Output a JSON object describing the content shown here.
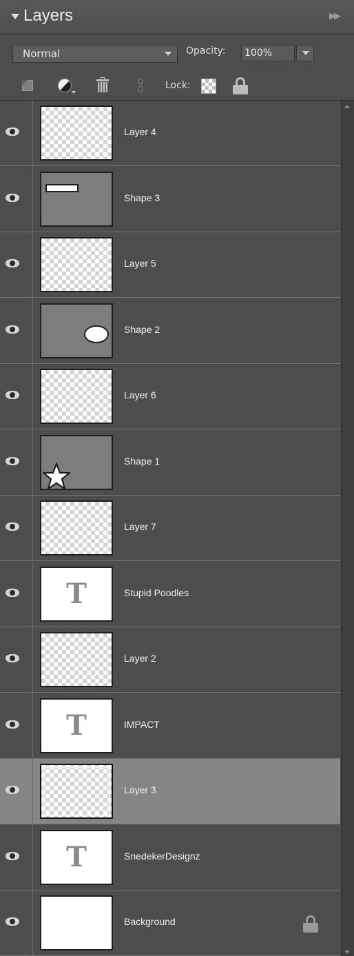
{
  "panel": {
    "title": "Layers",
    "menu_glyph": "▶▶"
  },
  "options": {
    "blend_mode": "Normal",
    "opacity_label": "Opacity:",
    "opacity_value": "100%"
  },
  "tools": {
    "lock_label": "Lock:"
  },
  "layers": [
    {
      "name": "Layer 4",
      "thumb": "transparent",
      "visible": true
    },
    {
      "name": "Shape 3",
      "thumb": "shape-rectangle",
      "visible": true
    },
    {
      "name": "Layer 5",
      "thumb": "transparent",
      "visible": true
    },
    {
      "name": "Shape 2",
      "thumb": "shape-ellipse",
      "visible": true
    },
    {
      "name": "Layer 6",
      "thumb": "transparent",
      "visible": true
    },
    {
      "name": "Shape 1",
      "thumb": "shape-star",
      "visible": true
    },
    {
      "name": "Layer 7",
      "thumb": "transparent",
      "visible": true
    },
    {
      "name": "Stupid Poodles",
      "thumb": "text",
      "thumb_glyph": "T",
      "visible": true
    },
    {
      "name": "Layer 2",
      "thumb": "transparent",
      "visible": true
    },
    {
      "name": "IMPACT",
      "thumb": "text",
      "thumb_glyph": "T",
      "visible": true
    },
    {
      "name": "Layer 3",
      "thumb": "transparent",
      "visible": true,
      "selected": true
    },
    {
      "name": "SnedekerDesignz",
      "thumb": "text",
      "thumb_glyph": "T",
      "visible": true
    },
    {
      "name": "Background",
      "thumb": "white",
      "visible": true,
      "locked": true
    }
  ],
  "colors": {
    "panel_bg": "#4d4d4d",
    "selected_row": "#858585",
    "shape_fill": "#7d7d7d"
  }
}
